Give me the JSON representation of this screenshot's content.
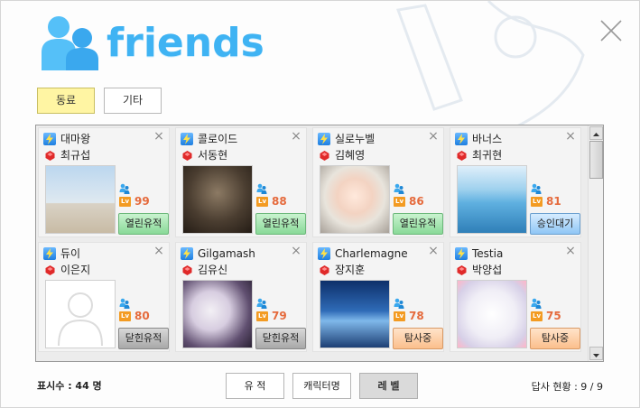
{
  "header": {
    "title": "friends"
  },
  "tabs": [
    {
      "label": "동료",
      "active": true
    },
    {
      "label": "기타",
      "active": false
    }
  ],
  "cards": [
    {
      "name": "대마왕",
      "character": "최규섭",
      "level": "99",
      "status": "열린유적",
      "status_color": "green"
    },
    {
      "name": "콜로이드",
      "character": "서동현",
      "level": "88",
      "status": "열린유적",
      "status_color": "green"
    },
    {
      "name": "실로누벨",
      "character": "김혜영",
      "level": "86",
      "status": "열린유적",
      "status_color": "green"
    },
    {
      "name": "바너스",
      "character": "최귀현",
      "level": "81",
      "status": "승인대기",
      "status_color": "blue"
    },
    {
      "name": "듀이",
      "character": "이은지",
      "level": "80",
      "status": "닫힌유적",
      "status_color": "gray"
    },
    {
      "name": "Gilgamash",
      "character": "김유신",
      "level": "79",
      "status": "닫힌유적",
      "status_color": "gray"
    },
    {
      "name": "Charlemagne",
      "character": "장지훈",
      "level": "78",
      "status": "탐사중",
      "status_color": "orange"
    },
    {
      "name": "Testia",
      "character": "박양섭",
      "level": "75",
      "status": "탐사중",
      "status_color": "orange"
    }
  ],
  "level_badge": "Lv",
  "footer": {
    "count_label": "표시수 : 44 명",
    "buttons": [
      {
        "label": "유 적"
      },
      {
        "label": "캐릭터명"
      },
      {
        "label": "레 벨"
      }
    ],
    "status_label": "답사 현황 : 9 / 9"
  },
  "colors": {
    "accent": "#3fb3f3",
    "level": "#e56a3c",
    "tab_active": "#fff5a3"
  },
  "icons": [
    "friends-logo-icon",
    "close-icon",
    "lightning-icon",
    "red-gem-icon",
    "user-icon",
    "level-icon"
  ]
}
